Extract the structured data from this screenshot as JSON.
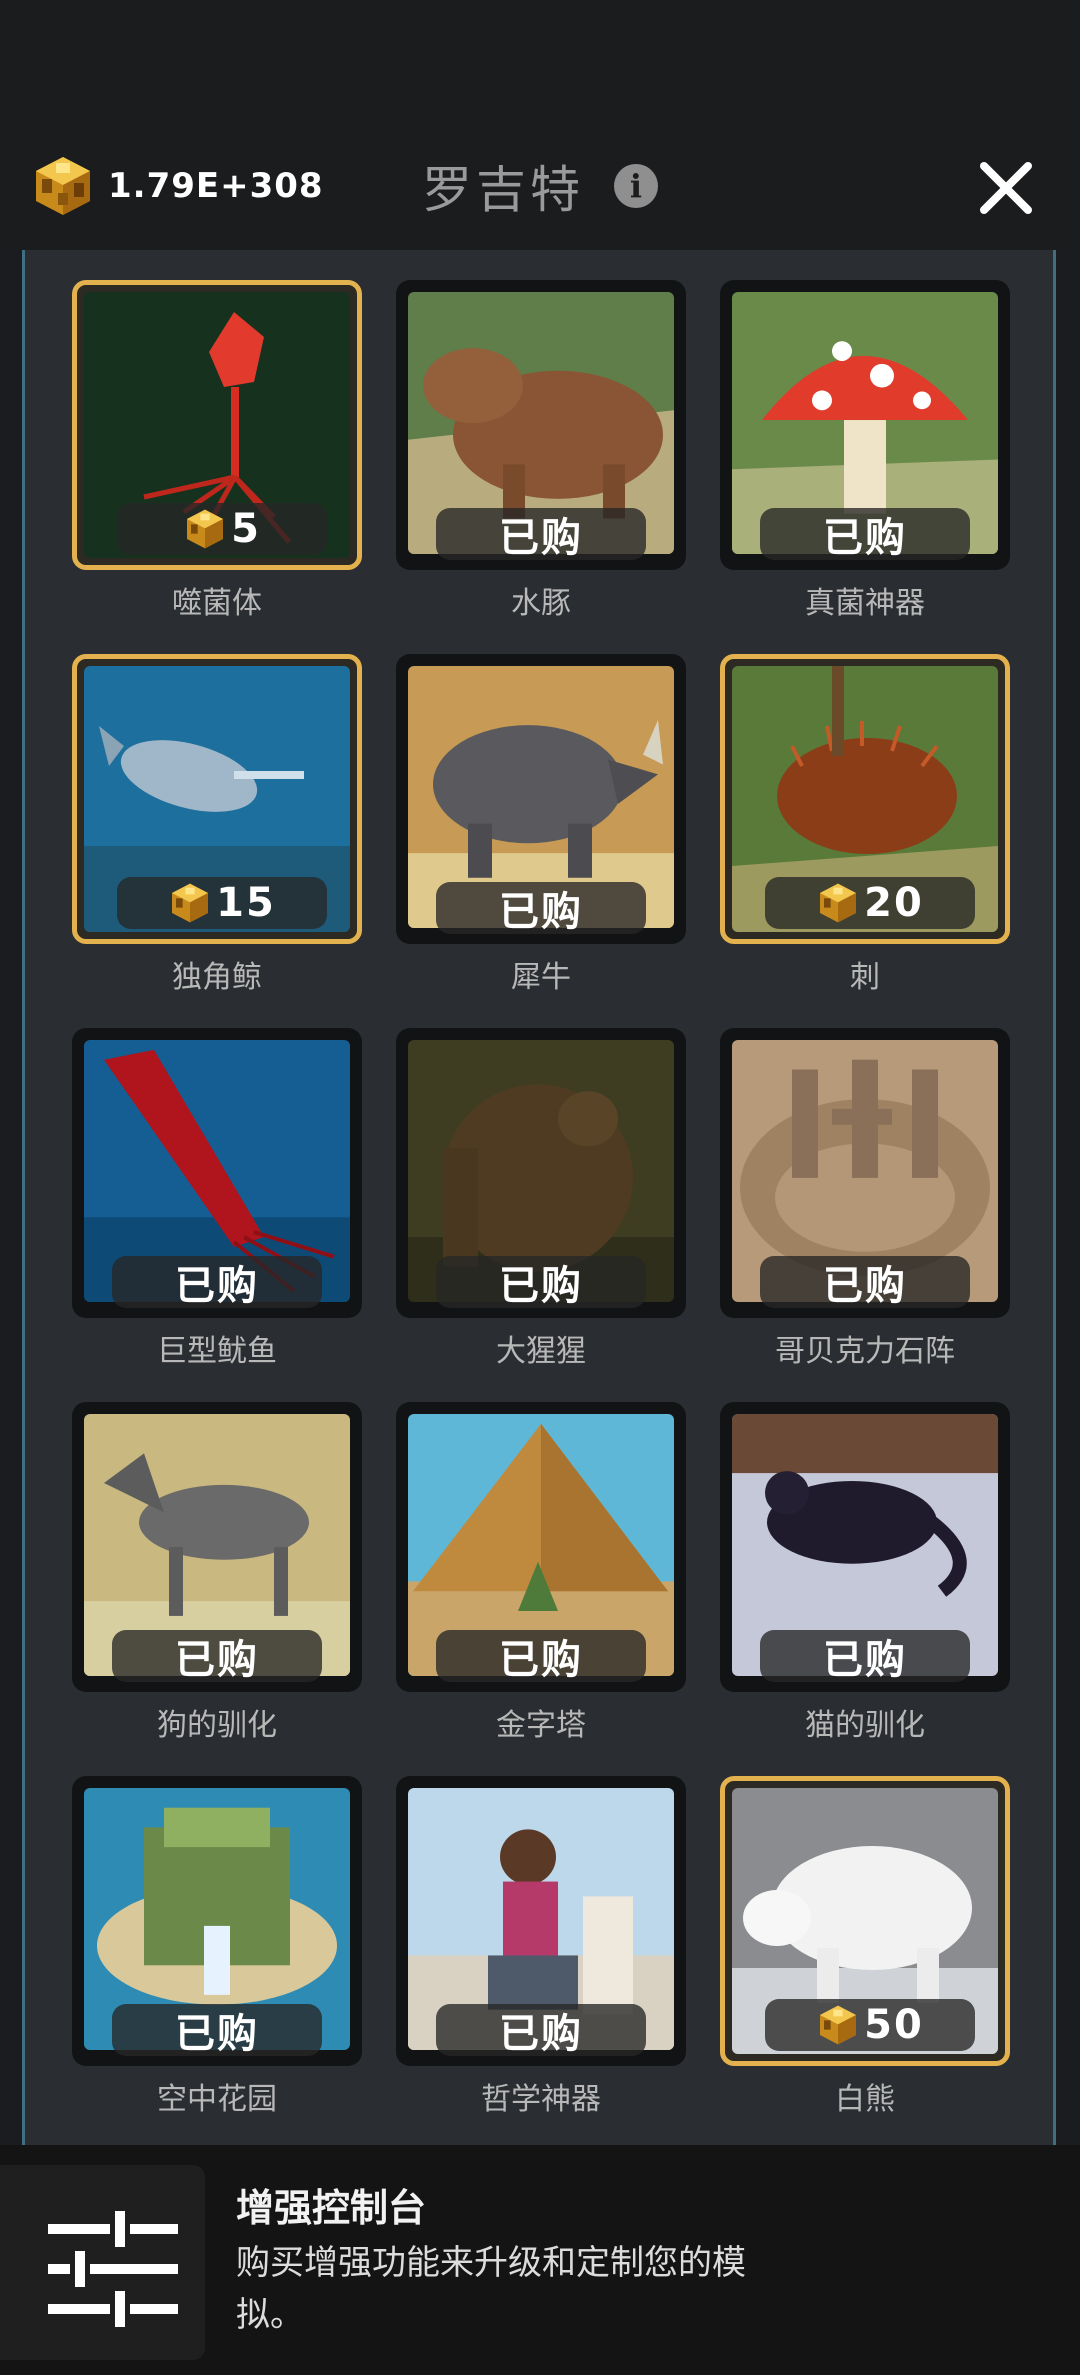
{
  "header": {
    "currency_amount": "1.79E+308",
    "currency_icon": "gold-cube-icon",
    "title": "罗吉特",
    "info_icon": "info-icon",
    "close_icon": "close-icon"
  },
  "colors": {
    "gold_border": "#e3b24e",
    "panel_bg": "#2a2d31",
    "panel_edge": "#3f6f80"
  },
  "items": [
    {
      "name": "噬菌体",
      "status": "price",
      "price": "5"
    },
    {
      "name": "水豚",
      "status": "owned",
      "owned_label": "已购"
    },
    {
      "name": "真菌神器",
      "status": "owned",
      "owned_label": "已购"
    },
    {
      "name": "独角鲸",
      "status": "price",
      "price": "15"
    },
    {
      "name": "犀牛",
      "status": "owned",
      "owned_label": "已购"
    },
    {
      "name": "刺",
      "status": "price",
      "price": "20"
    },
    {
      "name": "巨型鱿鱼",
      "status": "owned",
      "owned_label": "已购"
    },
    {
      "name": "大猩猩",
      "status": "owned",
      "owned_label": "已购"
    },
    {
      "name": "哥贝克力石阵",
      "status": "owned",
      "owned_label": "已购"
    },
    {
      "name": "狗的驯化",
      "status": "owned",
      "owned_label": "已购"
    },
    {
      "name": "金字塔",
      "status": "owned",
      "owned_label": "已购"
    },
    {
      "name": "猫的驯化",
      "status": "owned",
      "owned_label": "已购"
    },
    {
      "name": "空中花园",
      "status": "owned",
      "owned_label": "已购"
    },
    {
      "name": "哲学神器",
      "status": "owned",
      "owned_label": "已购"
    },
    {
      "name": "白熊",
      "status": "price",
      "price": "50"
    }
  ],
  "footer": {
    "icon": "sliders-icon",
    "title": "增强控制台",
    "description": "购买增强功能来升级和定制您的模拟。"
  }
}
